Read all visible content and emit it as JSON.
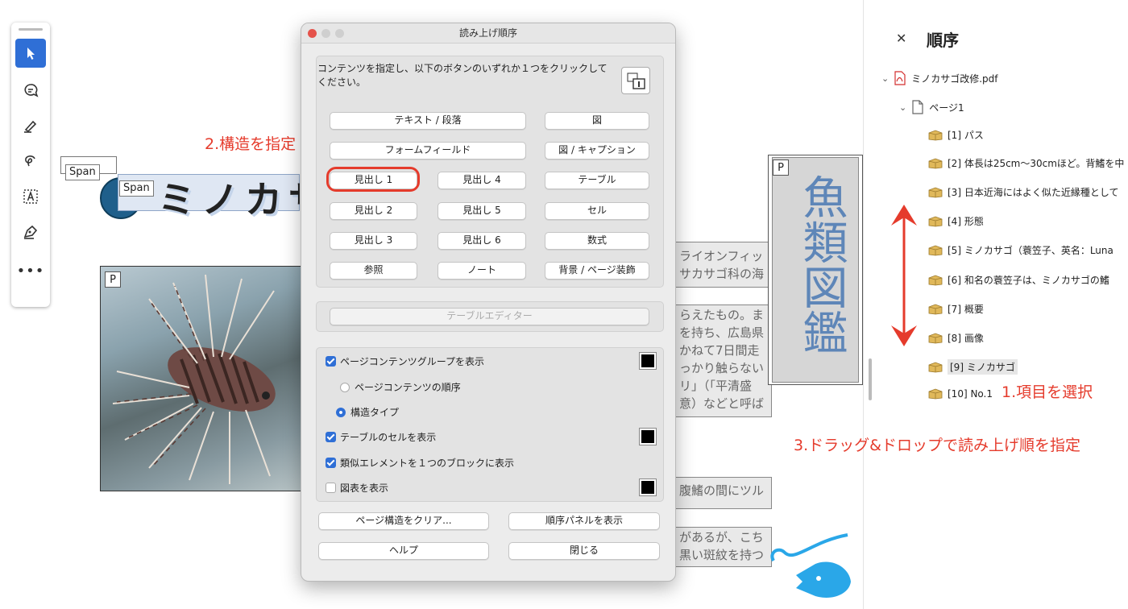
{
  "dialog": {
    "title": "読み上げ順序",
    "instruction": "コンテンツを指定し、以下のボタンのいずれか１つをクリックしてください。",
    "buttons": {
      "text_paragraph": "テキスト / 段落",
      "figure": "図",
      "form_field": "フォームフィールド",
      "figure_caption": "図 / キャプション",
      "heading1": "見出し 1",
      "heading4": "見出し 4",
      "table": "テーブル",
      "heading2": "見出し 2",
      "heading5": "見出し 5",
      "cell": "セル",
      "heading3": "見出し 3",
      "heading6": "見出し 6",
      "formula": "数式",
      "reference": "参照",
      "note": "ノート",
      "background": "背景 / ページ装飾",
      "table_editor": "テーブルエディター",
      "clear_structure": "ページ構造をクリア...",
      "show_order_panel": "順序パネルを表示",
      "help": "ヘルプ",
      "close": "閉じる"
    },
    "options": {
      "show_page_content_groups": "ページコンテンツグループを表示",
      "page_content_order": "ページコンテンツの順序",
      "structure_type": "構造タイプ",
      "show_table_cells": "テーブルのセルを表示",
      "similar_elements_block": "類似エレメントを１つのブロックに表示",
      "show_figures": "図表を表示"
    }
  },
  "page": {
    "span_tag_outer": "Span",
    "span_tag_inner": "Span",
    "title_text": "ミノカサ",
    "p_tag_photo": "P",
    "p_tag_vertical": "P",
    "vertical_text": "魚類図鑑",
    "text_block1": [
      "ライオンフィッ",
      "サカサゴ科の海"
    ],
    "text_block2": [
      "らえたもの。ま",
      "を持ち、広島県",
      "かねて7日間走",
      "っかり触らない",
      "リ」（「平清盛",
      "意）などと呼ば"
    ],
    "text_block3": "腹鰭の間にツル",
    "text_block4": [
      "があるが、こち",
      "黒い斑紋を持つ"
    ]
  },
  "order_panel": {
    "title": "順序",
    "file": "ミノカサゴ改修.pdf",
    "page": "ページ1",
    "items": [
      "[1] パス",
      "[2] 体長は25cm〜30cmほど。背鰭を中",
      "[3] 日本近海にはよく似た近縁種として",
      "[4] 形態",
      "[5] ミノカサゴ（蓑笠子、英名：Luna",
      "[6] 和名の蓑笠子は、ミノカサゴの鰭",
      "[7] 概要",
      "[8] 画像",
      "[9] ミノカサゴ",
      "[10] No.1"
    ]
  },
  "annotations": {
    "step1": "1.項目を選択",
    "step2": "2.構造を指定",
    "step3": "3.ドラッグ&ドロップで読み上げ順を指定"
  },
  "colors": {
    "accent": "#2f6fd6",
    "annotation": "#e53b2c",
    "vertical_text": "#5e86b8"
  }
}
